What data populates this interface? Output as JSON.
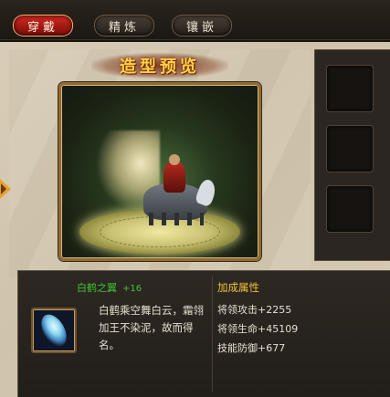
{
  "tabs": [
    {
      "label": "穿戴",
      "active": true
    },
    {
      "label": "精炼",
      "active": false
    },
    {
      "label": "镶嵌",
      "active": false
    }
  ],
  "preview": {
    "title": "造型预览"
  },
  "item": {
    "name": "白鹤之翼",
    "enhance": "+16",
    "description": "白鹤乘空舞白云，霜翎加王不染泥，故而得名。"
  },
  "attributes": {
    "title": "加成属性",
    "lines": [
      "将领攻击+2255",
      "将领生命+45109",
      "技能防御+677"
    ]
  },
  "colors": {
    "name_green": "#3ec238",
    "attr_gold": "#f2c23a",
    "tab_active": "#d22820"
  }
}
